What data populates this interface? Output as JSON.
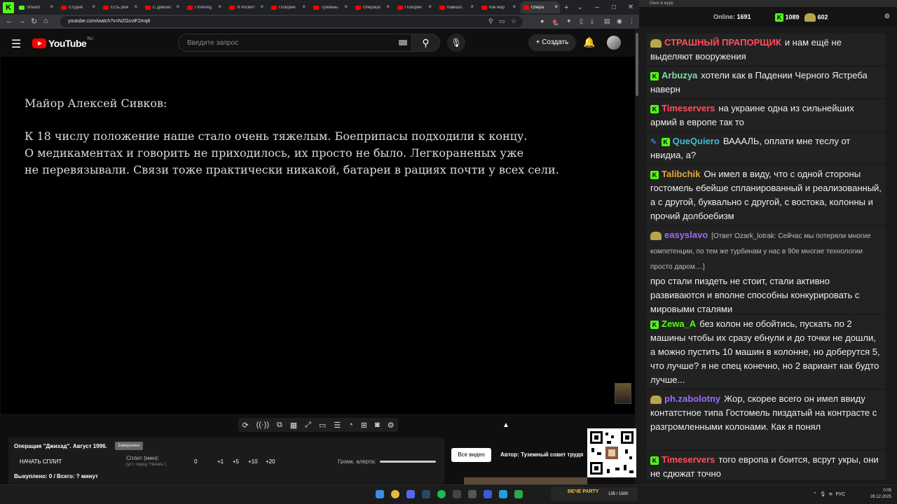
{
  "browser": {
    "tabs": [
      {
        "title": "Stream",
        "kind": "kick"
      },
      {
        "title": "Студия",
        "kind": "yt"
      },
      {
        "title": "Есть реж",
        "kind": "yt"
      },
      {
        "title": "С Девоно",
        "kind": "yt"
      },
      {
        "title": "I Investig",
        "kind": "yt"
      },
      {
        "title": "Я посмот",
        "kind": "yt"
      },
      {
        "title": "Позорни",
        "kind": "yt"
      },
      {
        "title": "Туземны",
        "kind": "yt"
      },
      {
        "title": "Операци",
        "kind": "yt"
      },
      {
        "title": "Позорни",
        "kind": "yt"
      },
      {
        "title": "Кавказс",
        "kind": "yt"
      },
      {
        "title": "Как мар",
        "kind": "yt"
      },
      {
        "title": "Опера",
        "kind": "yt",
        "active": true
      }
    ],
    "url": "youtube.com/watch?v=NZGcvtF2mq8",
    "extension_badge": "782"
  },
  "youtube": {
    "logo_text": "YouTube",
    "region": "RU",
    "search_placeholder": "Введите запрос",
    "create_label": "Создать",
    "icons": [
      "menu-icon",
      "search-icon",
      "mic-icon",
      "bell-icon"
    ]
  },
  "video": {
    "speaker": "Майор Алексей Сивков:",
    "lines": [
      "К 18 числу положение наше стало очень тяжелым. Боеприпасы подходили к концу.",
      "О медикаментах и говорить не приходилось, их просто не было. Легкораненых уже",
      "не перевязывали. Связи тоже практически никакой, батареи в рациях почти у всех сели."
    ]
  },
  "splits": {
    "title": "Операция \"Джихад\". Август 1996.",
    "badge": "Завершено",
    "start_label": "НАЧАТЬ СПЛИТ",
    "split_label": "Сплит (мин):",
    "split_hint": "(уст. перед \"Начать\")",
    "split_value": "0",
    "increments": [
      "+1",
      "+5",
      "+10",
      "+20"
    ],
    "alert_label": "Громк. алерта:",
    "footer": "Выкуплено: 0 / Всего: ? минут",
    "all_videos": "Все видео",
    "author": "Автор: Туземный совет трудя"
  },
  "chat": {
    "window_title": "Окно в журу",
    "online_label": "Online:",
    "online_value": "1691",
    "kick_count": "1089",
    "coin_count": "602",
    "messages": [
      {
        "user": "СТРАШНЫЙ ПРАПОРЩИК",
        "color": "#ff4f5e",
        "badge": "blob",
        "text": "и нам ещё не выделяют вооружения"
      },
      {
        "user": "Arbuzya",
        "color": "#7ed9a8",
        "badge": "kick",
        "text": "хотели как в Падении Черного Ястреба наверн"
      },
      {
        "user": "Timeservers",
        "color": "#ff4f5e",
        "badge": "kick",
        "text": "на украине одна из сильнейших армий в европе так то"
      },
      {
        "user": "QueQuiero",
        "color": "#3fbfd8",
        "badge": "sword-kick",
        "text": "ВАААЛЬ, оплати мне теслу от нвидиа, а?"
      },
      {
        "user": "Talibchik",
        "color": "#e3a63a",
        "badge": "kick",
        "text": "Он имел в виду, что с одной стороны гостомель ебейше спланированный и реализованный, а с другой, буквально с другой, с востока, колонны и прочий долбоебизм"
      },
      {
        "user": "easyslavo",
        "color": "#9a6bff",
        "badge": "blob",
        "reply": "[Ответ Ozark_lotrak: Сейчас мы потеряли многие компетенции, по тем же турбинам у нас в 90е многие технологии просто даром....]",
        "text": "про стали пиздеть не стоит, стали активно развиваются и вполне способны конкурировать с мировыми сталями"
      },
      {
        "user": "Zewa_A",
        "color": "#53fc18",
        "badge": "kick",
        "text": "без колон не обойтись, пускать по 2 машины чтобы их сразу ебнули и до точки не дошли, а можно пустить 10 машин в колонне, но доберутся 5, что лучше? я не спец конечно, но 2 вариант как будто лучше..."
      },
      {
        "user": "ph.zabolotny",
        "color": "#9a6bff",
        "badge": "blob",
        "text": "Жор, скорее всего он имел ввиду контатстное типа Гостомель пиздатый на контрасте с разгромленными колонами. Как я понял"
      },
      {
        "user": "Timeservers",
        "color": "#ff4f5e",
        "badge": "kick",
        "text": "того европа и боится, всрут укры, они не сдюжат точно"
      }
    ]
  },
  "taskbar": {
    "kick_party": "ВЕЧЕ PARTY",
    "party_count": "135 / 1500",
    "lang": "РУС",
    "time": "0:05",
    "date": "28.12.2025"
  }
}
